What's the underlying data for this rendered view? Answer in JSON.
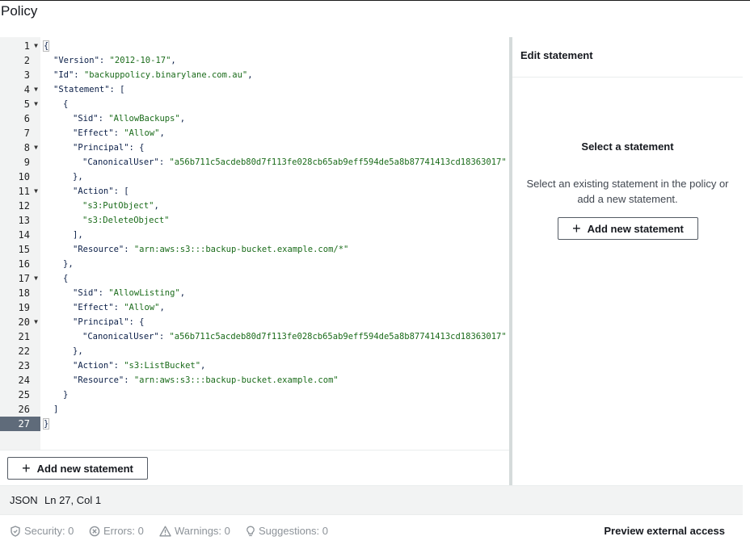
{
  "page": {
    "title": "Policy"
  },
  "editor": {
    "lines": [
      {
        "n": "1",
        "fold": true,
        "indent": 0,
        "parts": [
          [
            "p",
            "{"
          ]
        ]
      },
      {
        "n": "2",
        "fold": false,
        "indent": 1,
        "parts": [
          [
            "p",
            "\"Version\": "
          ],
          [
            "s",
            "\"2012-10-17\""
          ],
          [
            "p",
            ","
          ]
        ]
      },
      {
        "n": "3",
        "fold": false,
        "indent": 1,
        "parts": [
          [
            "p",
            "\"Id\": "
          ],
          [
            "s",
            "\"backuppolicy.binarylane.com.au\""
          ],
          [
            "p",
            ","
          ]
        ]
      },
      {
        "n": "4",
        "fold": true,
        "indent": 1,
        "parts": [
          [
            "p",
            "\"Statement\": ["
          ]
        ]
      },
      {
        "n": "5",
        "fold": true,
        "indent": 2,
        "parts": [
          [
            "p",
            "{"
          ]
        ]
      },
      {
        "n": "6",
        "fold": false,
        "indent": 3,
        "parts": [
          [
            "p",
            "\"Sid\": "
          ],
          [
            "s",
            "\"AllowBackups\""
          ],
          [
            "p",
            ","
          ]
        ]
      },
      {
        "n": "7",
        "fold": false,
        "indent": 3,
        "parts": [
          [
            "p",
            "\"Effect\": "
          ],
          [
            "s",
            "\"Allow\""
          ],
          [
            "p",
            ","
          ]
        ]
      },
      {
        "n": "8",
        "fold": true,
        "indent": 3,
        "parts": [
          [
            "p",
            "\"Principal\": {"
          ]
        ]
      },
      {
        "n": "9",
        "fold": false,
        "indent": 4,
        "parts": [
          [
            "p",
            "\"CanonicalUser\": "
          ],
          [
            "s",
            "\"a56b711c5acdeb80d7f113fe028cb65ab9eff594de5a8b87741413cd18363017\""
          ]
        ]
      },
      {
        "n": "10",
        "fold": false,
        "indent": 3,
        "parts": [
          [
            "p",
            "},"
          ]
        ]
      },
      {
        "n": "11",
        "fold": true,
        "indent": 3,
        "parts": [
          [
            "p",
            "\"Action\": ["
          ]
        ]
      },
      {
        "n": "12",
        "fold": false,
        "indent": 4,
        "parts": [
          [
            "s",
            "\"s3:PutObject\""
          ],
          [
            "p",
            ","
          ]
        ]
      },
      {
        "n": "13",
        "fold": false,
        "indent": 4,
        "parts": [
          [
            "s",
            "\"s3:DeleteObject\""
          ]
        ]
      },
      {
        "n": "14",
        "fold": false,
        "indent": 3,
        "parts": [
          [
            "p",
            "],"
          ]
        ]
      },
      {
        "n": "15",
        "fold": false,
        "indent": 3,
        "parts": [
          [
            "p",
            "\"Resource\": "
          ],
          [
            "s",
            "\"arn:aws:s3:::backup-bucket.example.com/*\""
          ]
        ]
      },
      {
        "n": "16",
        "fold": false,
        "indent": 2,
        "parts": [
          [
            "p",
            "},"
          ]
        ]
      },
      {
        "n": "17",
        "fold": true,
        "indent": 2,
        "parts": [
          [
            "p",
            "{"
          ]
        ]
      },
      {
        "n": "18",
        "fold": false,
        "indent": 3,
        "parts": [
          [
            "p",
            "\"Sid\": "
          ],
          [
            "s",
            "\"AllowListing\""
          ],
          [
            "p",
            ","
          ]
        ]
      },
      {
        "n": "19",
        "fold": false,
        "indent": 3,
        "parts": [
          [
            "p",
            "\"Effect\": "
          ],
          [
            "s",
            "\"Allow\""
          ],
          [
            "p",
            ","
          ]
        ]
      },
      {
        "n": "20",
        "fold": true,
        "indent": 3,
        "parts": [
          [
            "p",
            "\"Principal\": {"
          ]
        ]
      },
      {
        "n": "21",
        "fold": false,
        "indent": 4,
        "parts": [
          [
            "p",
            "\"CanonicalUser\": "
          ],
          [
            "s",
            "\"a56b711c5acdeb80d7f113fe028cb65ab9eff594de5a8b87741413cd18363017\""
          ]
        ]
      },
      {
        "n": "22",
        "fold": false,
        "indent": 3,
        "parts": [
          [
            "p",
            "},"
          ]
        ]
      },
      {
        "n": "23",
        "fold": false,
        "indent": 3,
        "parts": [
          [
            "p",
            "\"Action\": "
          ],
          [
            "s",
            "\"s3:ListBucket\""
          ],
          [
            "p",
            ","
          ]
        ]
      },
      {
        "n": "24",
        "fold": false,
        "indent": 3,
        "parts": [
          [
            "p",
            "\"Resource\": "
          ],
          [
            "s",
            "\"arn:aws:s3:::backup-bucket.example.com\""
          ]
        ]
      },
      {
        "n": "25",
        "fold": false,
        "indent": 2,
        "parts": [
          [
            "p",
            "}"
          ]
        ]
      },
      {
        "n": "26",
        "fold": false,
        "indent": 1,
        "parts": [
          [
            "p",
            "]"
          ]
        ]
      },
      {
        "n": "27",
        "fold": false,
        "indent": 0,
        "active": true,
        "parts": [
          [
            "p",
            "}"
          ]
        ]
      }
    ],
    "add_button": {
      "icon": "plus-icon",
      "label": "Add new statement"
    }
  },
  "side_panel": {
    "header": "Edit statement",
    "empty_title": "Select a statement",
    "empty_description": "Select an existing statement in the policy or add a new statement.",
    "add_button": {
      "icon": "plus-icon",
      "label": "Add new statement"
    }
  },
  "status_bar": {
    "language": "JSON",
    "position": "Ln 27, Col 1"
  },
  "diagnostics": {
    "security": {
      "icon": "shield-icon",
      "label": "Security: 0"
    },
    "errors": {
      "icon": "error-circle-icon",
      "label": "Errors: 0"
    },
    "warnings": {
      "icon": "warning-triangle-icon",
      "label": "Warnings: 0"
    },
    "suggestions": {
      "icon": "lightbulb-icon",
      "label": "Suggestions: 0"
    },
    "preview_link": "Preview external access"
  }
}
